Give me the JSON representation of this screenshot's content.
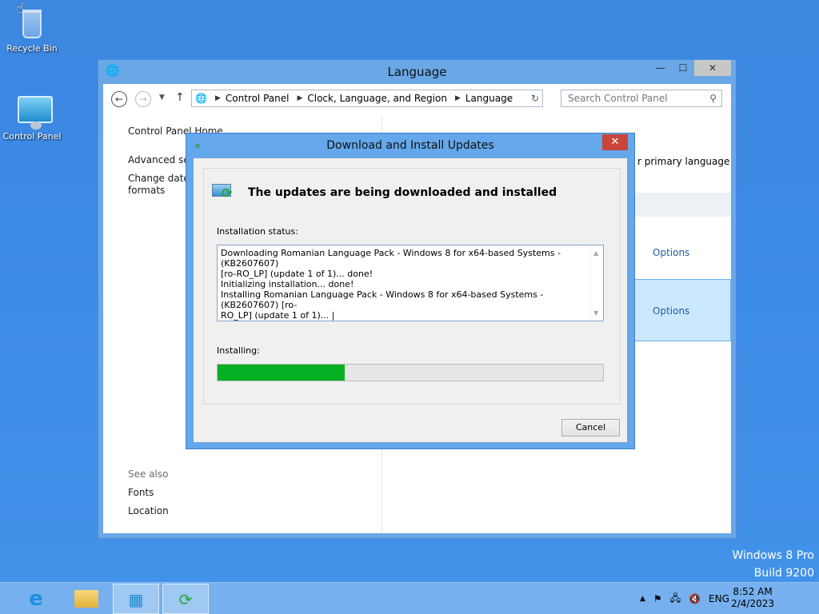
{
  "desktop": {
    "icons": [
      {
        "label": "Recycle Bin"
      },
      {
        "label": "Control Panel"
      }
    ],
    "watermark": {
      "line1": "Windows 8 Pro",
      "line2": "Build 9200"
    }
  },
  "window": {
    "title": "Language",
    "nav": {
      "breadcrumb": [
        "Control Panel",
        "Clock, Language, and Region",
        "Language"
      ],
      "search_placeholder": "Search Control Panel"
    },
    "left_pane": {
      "home": "Control Panel Home",
      "advanced": "Advanced sett",
      "change_date": "Change date,",
      "formats": "formats",
      "see_also": "See also",
      "fonts": "Fonts",
      "location": "Location"
    },
    "right_pane": {
      "primary_language": "r primary language",
      "options_1": "Options",
      "options_2": "Options"
    }
  },
  "dialog": {
    "title": "Download and Install Updates",
    "heading": "The updates are being downloaded and installed",
    "status_label": "Installation status:",
    "status_lines": [
      "Downloading Romanian Language Pack - Windows 8 for x64-based Systems - (KB2607607)",
      "[ro-RO_LP] (update 1 of 1)... done!",
      "Initializing installation... done!",
      "Installing Romanian Language Pack - Windows 8 for x64-based Systems - (KB2607607) [ro-",
      "RO_LP] (update 1 of 1)... |"
    ],
    "progress_label": "Installing:",
    "progress_fraction": 0.33,
    "cancel_label": "Cancel"
  },
  "taskbar": {
    "tray": {
      "language": "ENG",
      "time": "8:52 AM",
      "date": "2/4/2023"
    }
  },
  "colors": {
    "progress_fill": "#06b025",
    "link": "#1e5da8",
    "desktop": "#3b8ae6"
  }
}
